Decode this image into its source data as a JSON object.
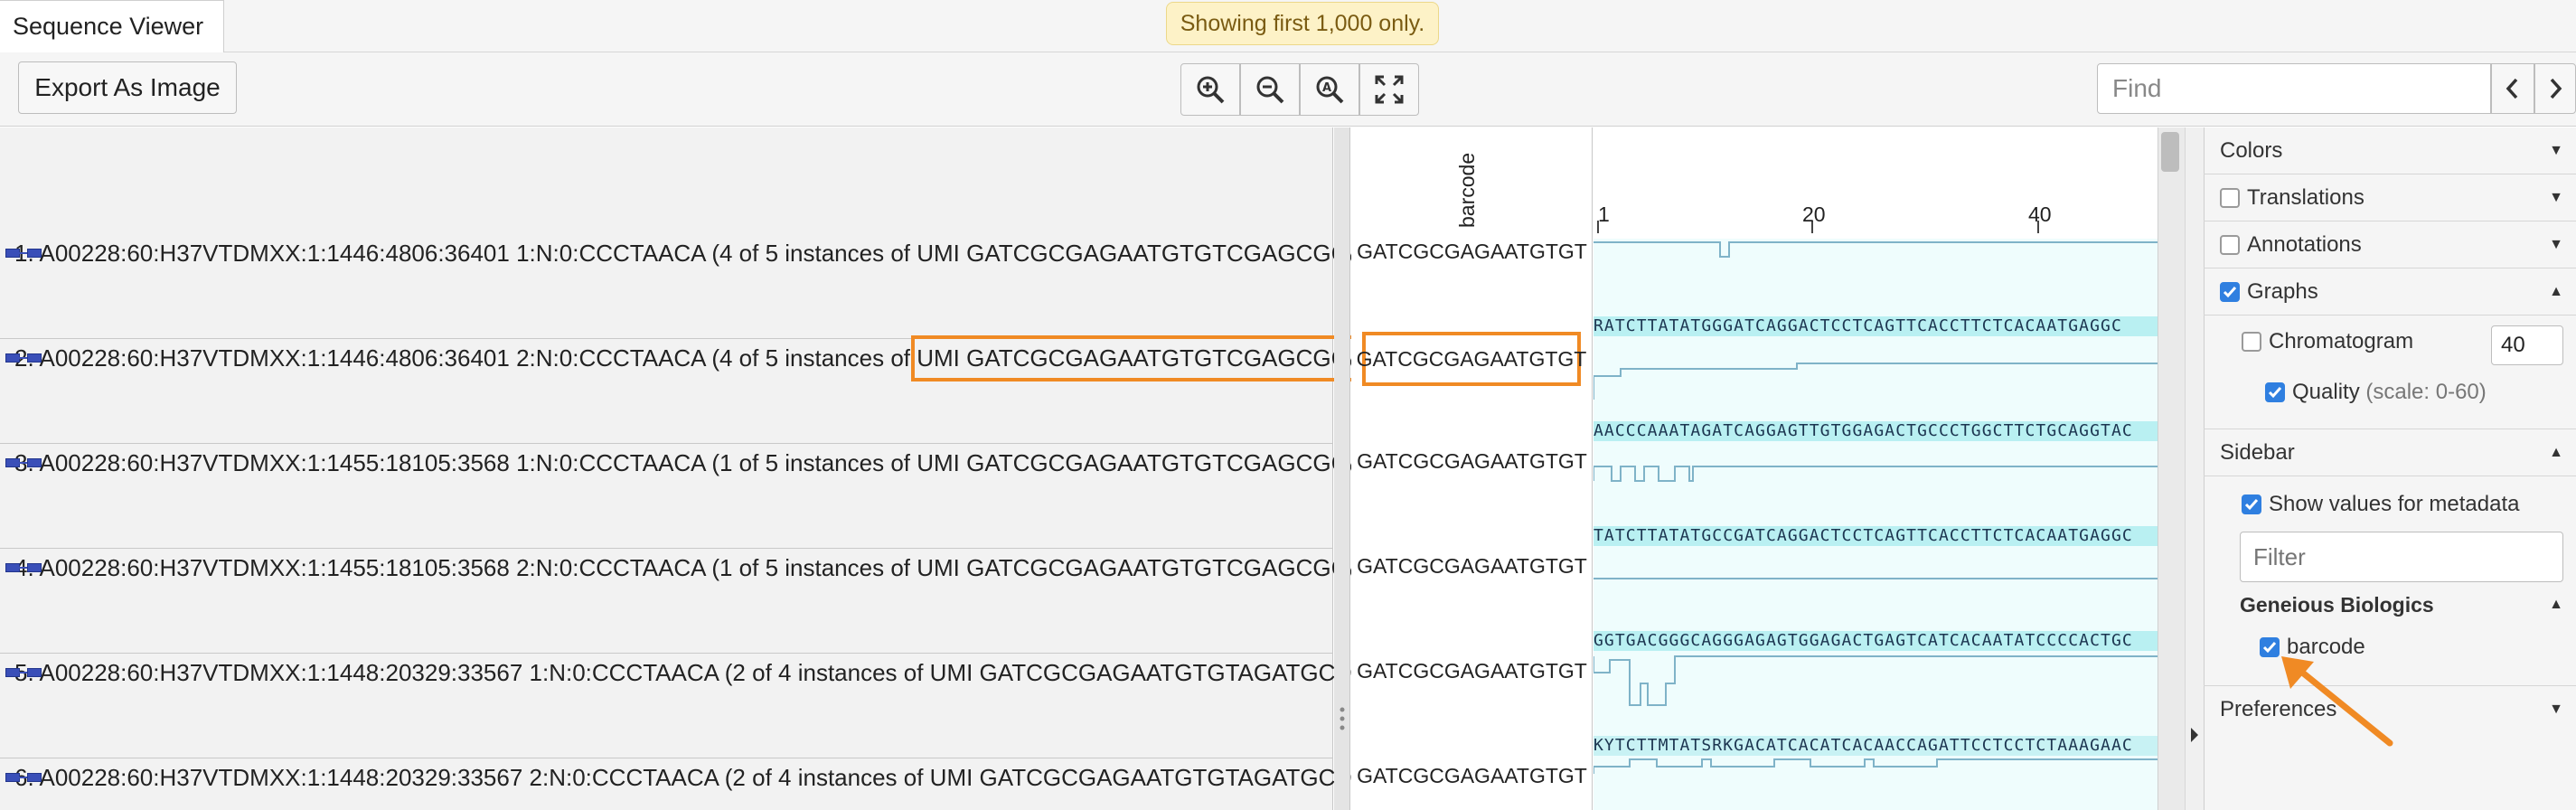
{
  "tab": {
    "label": "Sequence Viewer"
  },
  "notice": "Showing first 1,000 only.",
  "toolbar": {
    "export_label": "Export As Image",
    "zoom_buttons": [
      "zoom-in-icon",
      "zoom-out-icon",
      "zoom-to-fit-icon",
      "expand-icon"
    ],
    "find_placeholder": "Find"
  },
  "metadata_column": {
    "header": "barcode"
  },
  "sequences": [
    {
      "label": "1. A00228:60:H37VTDMXX:1:1446:4806:36401 1:N:0:CCCTAACA (4 of 5 instances of UMI GATCGCGAGAATGTGTCGAGCGCACA)",
      "barcode": "GATCGCGAGAATGTGT",
      "seq": ""
    },
    {
      "label_pre": "2. A00228:60:H37VTDMXX:1:1446:4806:36401 2:N:0:CCCTAACA (4 of 5 instances of ",
      "label_post": "UMI GATCGCGAGAATGTGTCGAGCGCACA)",
      "barcode": "GATCGCGAGAATGTGT",
      "seq": "RATCTTATATGGGATCAGGACTCCTCAGTTCACCTTCTCACAATGAGGC"
    },
    {
      "label": "3. A00228:60:H37VTDMXX:1:1455:18105:3568 1:N:0:CCCTAACA (1 of 5 instances of UMI GATCGCGAGAATGTGTCGAGCGCACA)",
      "barcode": "GATCGCGAGAATGTGT",
      "seq": "AACCCAAATAGATCAGGAGTTGTGGAGACTGCCCTGGCTTCTGCAGGTAC"
    },
    {
      "label": "4. A00228:60:H37VTDMXX:1:1455:18105:3568 2:N:0:CCCTAACA (1 of 5 instances of UMI GATCGCGAGAATGTGTCGAGCGCACA)",
      "barcode": "GATCGCGAGAATGTGT",
      "seq": "TATCTTATATGCCGATCAGGACTCCTCAGTTCACCTTCTCACAATGAGGC"
    },
    {
      "label": "5. A00228:60:H37VTDMXX:1:1448:20329:33567 1:N:0:CCCTAACA (2 of 4 instances of UMI GATCGCGAGAATGTGTAGATGCTGTA)",
      "barcode": "GATCGCGAGAATGTGT",
      "seq": "GGTGACGGGCAGGGAGAGTGGAGACTGAGTCATCACAATATCCCCACTGC"
    },
    {
      "label": "6. A00228:60:H37VTDMXX:1:1448:20329:33567 2:N:0:CCCTAACA (2 of 4 instances of UMI GATCGCGAGAATGTGTAGATGCTGTA)",
      "barcode": "GATCGCGAGAATGTGT",
      "seq": "KYTCTTMTATSRKGACATCACATCACAACCAGATTCCTCCTCTAAAGAAC"
    }
  ],
  "ruler": [
    "1",
    "20",
    "40"
  ],
  "panel": {
    "colors": "Colors",
    "translations": "Translations",
    "annotations": "Annotations",
    "graphs": "Graphs",
    "chromatogram": "Chromatogram",
    "chromatogram_value": "40",
    "quality": "Quality",
    "quality_scale": "(scale: 0-60)",
    "sidebar": "Sidebar",
    "show_values": "Show values for metadata",
    "filter_placeholder": "Filter",
    "group": "Geneious Biologics",
    "barcode": "barcode",
    "preferences": "Preferences"
  },
  "colors": {
    "highlight": "#f08a24",
    "checkbox": "#2f7fe0",
    "seq_band": "#b9f0f2"
  }
}
